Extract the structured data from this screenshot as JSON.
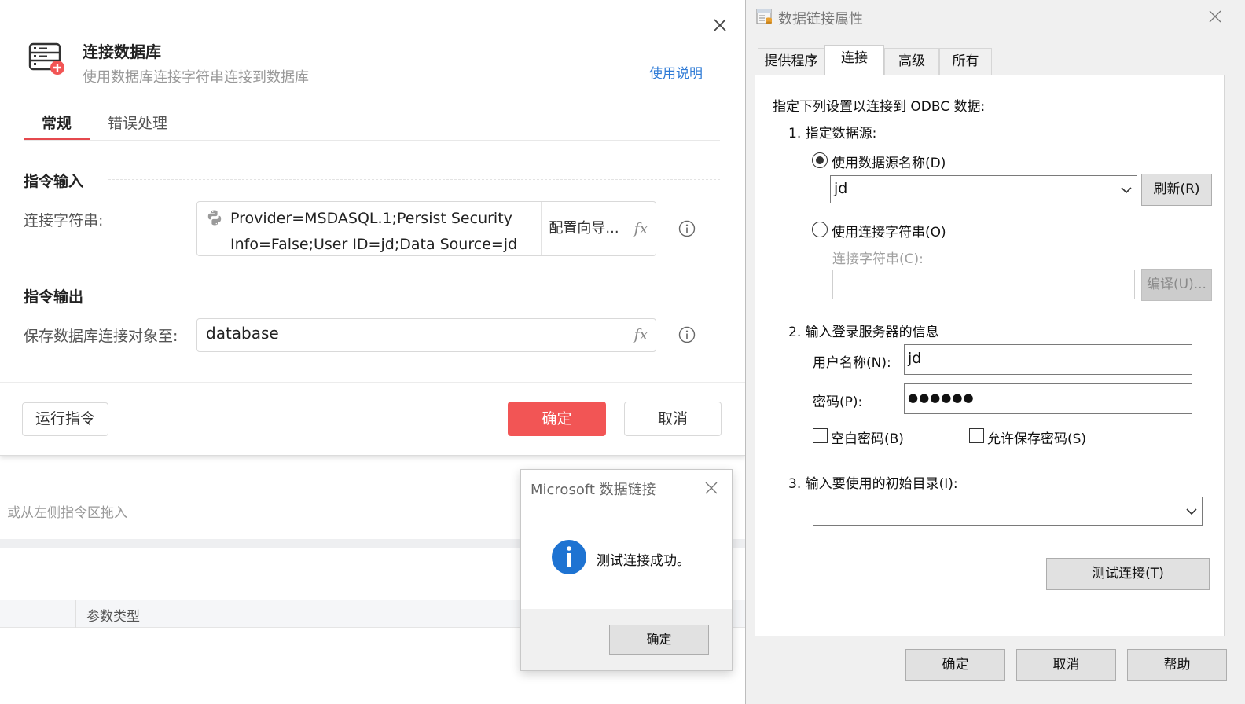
{
  "background": {
    "hint": "或从左侧指令区拖入",
    "param_type_header": "参数类型"
  },
  "dialog": {
    "title": "连接数据库",
    "subtitle": "使用数据库连接字符串连接到数据库",
    "help_link": "使用说明",
    "tabs": [
      {
        "label": "常规",
        "active": true
      },
      {
        "label": "错误处理",
        "active": false
      }
    ],
    "input_section": "指令输入",
    "conn_label": "连接字符串:",
    "conn_value_line1": "Provider=MSDASQL.1;Persist Security",
    "conn_value_line2": "Info=False;User ID=jd;Data Source=jd",
    "wizard_button": "配置向导...",
    "fx": "fx",
    "output_section": "指令输出",
    "save_label": "保存数据库连接对象至:",
    "save_value": "database",
    "run_button": "运行指令",
    "ok_button": "确定",
    "cancel_button": "取消",
    "accent_color": "#f25555",
    "link_color": "#2f7bd6"
  },
  "msgbox": {
    "title": "Microsoft 数据链接",
    "message": "测试连接成功。",
    "ok_button": "确定",
    "icon": "info-icon"
  },
  "datalink": {
    "title": "数据链接属性",
    "tabs": [
      {
        "label": "提供程序",
        "active": false
      },
      {
        "label": "连接",
        "active": true
      },
      {
        "label": "高级",
        "active": false
      },
      {
        "label": "所有",
        "active": false
      }
    ],
    "intro": "指定下列设置以连接到 ODBC 数据:",
    "step1": "1. 指定数据源:",
    "radio_dsn": "使用数据源名称(D)",
    "radio_dsn_selected": true,
    "dsn_value": "jd",
    "refresh_button": "刷新(R)",
    "radio_connstr": "使用连接字符串(O)",
    "connstr_label": "连接字符串(C):",
    "connstr_value": "",
    "compile_button": "编译(U)...",
    "step2": "2. 输入登录服务器的信息",
    "username_label": "用户名称(N):",
    "username_value": "jd",
    "password_label": "密码(P):",
    "password_value": "●●●●●●",
    "blank_password": "空白密码(B)",
    "allow_save_password": "允许保存密码(S)",
    "step3": "3. 输入要使用的初始目录(I):",
    "catalog_value": "",
    "test_button": "测试连接(T)",
    "ok_button": "确定",
    "cancel_button": "取消",
    "help_button": "帮助"
  }
}
